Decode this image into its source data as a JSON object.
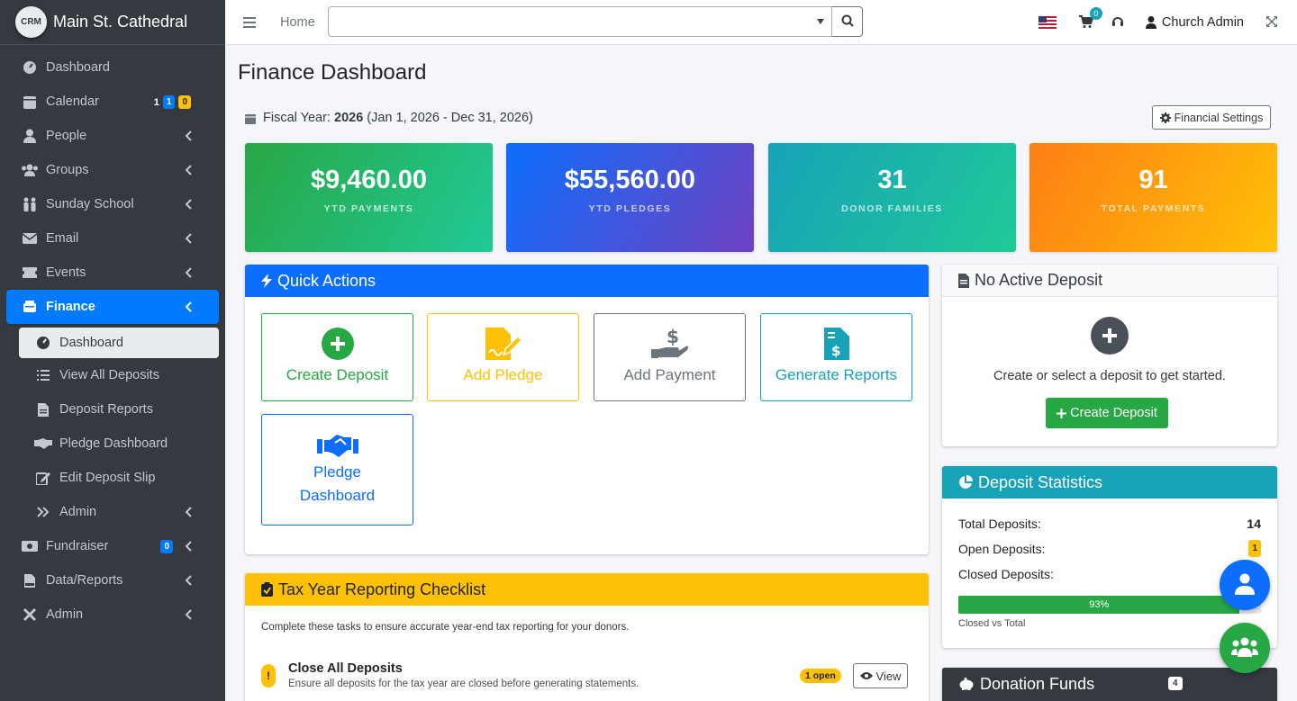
{
  "brand": {
    "logo_text": "CRM",
    "name": "Main St. Cathedral"
  },
  "sidebar": {
    "items": [
      {
        "label": "Dashboard",
        "icon": "tachometer-icon"
      },
      {
        "label": "Calendar",
        "icon": "calendar-icon",
        "badges": [
          "1",
          "1",
          "0"
        ]
      },
      {
        "label": "People",
        "icon": "user-icon"
      },
      {
        "label": "Groups",
        "icon": "users-icon"
      },
      {
        "label": "Sunday School",
        "icon": "children-icon"
      },
      {
        "label": "Email",
        "icon": "envelope-icon"
      },
      {
        "label": "Events",
        "icon": "ticket-icon"
      },
      {
        "label": "Finance",
        "icon": "bank-icon"
      }
    ],
    "finance_sub": [
      {
        "label": "Dashboard",
        "icon": "tachometer-icon"
      },
      {
        "label": "View All Deposits",
        "icon": "list-icon"
      },
      {
        "label": "Deposit Reports",
        "icon": "file-icon"
      },
      {
        "label": "Pledge Dashboard",
        "icon": "handshake-icon"
      },
      {
        "label": "Edit Deposit Slip",
        "icon": "edit-icon"
      },
      {
        "label": "Admin",
        "icon": "angles-right-icon"
      }
    ],
    "after": [
      {
        "label": "Fundraiser",
        "icon": "money-icon",
        "badge": "0"
      },
      {
        "label": "Data/Reports",
        "icon": "file-pdf-icon"
      },
      {
        "label": "Admin",
        "icon": "tools-icon"
      }
    ]
  },
  "topbar": {
    "home": "Home",
    "search_value": "",
    "cart_count": "0",
    "user_name": "Church Admin"
  },
  "page": {
    "title": "Finance Dashboard",
    "fiscal_label": "Fiscal Year: ",
    "fiscal_year": "2026",
    "fiscal_range": " (Jan 1, 2026 - Dec 31, 2026)",
    "settings_label": "Financial Settings"
  },
  "stats": [
    {
      "value": "$9,460.00",
      "label": "YTD PAYMENTS"
    },
    {
      "value": "$55,560.00",
      "label": "YTD PLEDGES"
    },
    {
      "value": "31",
      "label": "DONOR FAMILIES"
    },
    {
      "value": "91",
      "label": "TOTAL PAYMENTS"
    }
  ],
  "quick_actions": {
    "title": "Quick Actions",
    "buttons": [
      {
        "label": "Create Deposit"
      },
      {
        "label": "Add Pledge"
      },
      {
        "label": "Add Payment"
      },
      {
        "label": "Generate Reports"
      },
      {
        "label": "Pledge Dashboard"
      }
    ]
  },
  "no_deposit": {
    "title": "No Active Deposit",
    "message": "Create or select a deposit to get started.",
    "button": "Create Deposit"
  },
  "deposit_stats": {
    "title": "Deposit Statistics",
    "total_label": "Total Deposits:",
    "total_value": "14",
    "open_label": "Open Deposits:",
    "open_value": "1",
    "closed_label": "Closed Deposits:",
    "progress_text": "93%",
    "progress_fraction": 0.93,
    "progress_caption": "Closed vs Total"
  },
  "tax": {
    "title": "Tax Year Reporting Checklist",
    "intro": "Complete these tasks to ensure accurate year-end tax reporting for your donors.",
    "item_title": "Close All Deposits",
    "item_desc": "Ensure all deposits for the tax year are closed before generating statements.",
    "item_badge": "1 open",
    "item_button": "View",
    "warn": "!"
  },
  "donation_funds": {
    "title": "Donation Funds",
    "count": "4"
  },
  "colors": {
    "primary": "#0d6efd",
    "success": "#28a745",
    "warning": "#ffc107",
    "info": "#17a2b8",
    "sidebar": "#343a40"
  }
}
